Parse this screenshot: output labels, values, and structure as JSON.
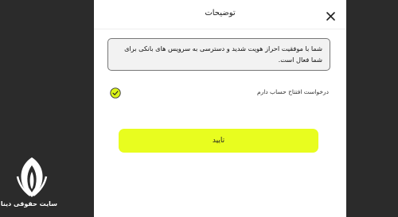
{
  "modal": {
    "title": "توضیحات",
    "message": "شما با موفقیت احراز هویت شدید و دسترسی به سرویس های بانکی برای شما فعال است.",
    "checkbox_label": "درخواست افتتاح حساب دارم",
    "checkbox_checked": true,
    "confirm_label": "تایید"
  },
  "watermark": {
    "site_name": "سایت حقوقی دینا"
  },
  "colors": {
    "backdrop": "#2b2b2b",
    "accent": "#e8fd1f",
    "check_fill": "#dcf51a"
  },
  "icons": {
    "close": "close-icon",
    "check": "check-circle-icon",
    "logo": "dina-logo-icon"
  }
}
